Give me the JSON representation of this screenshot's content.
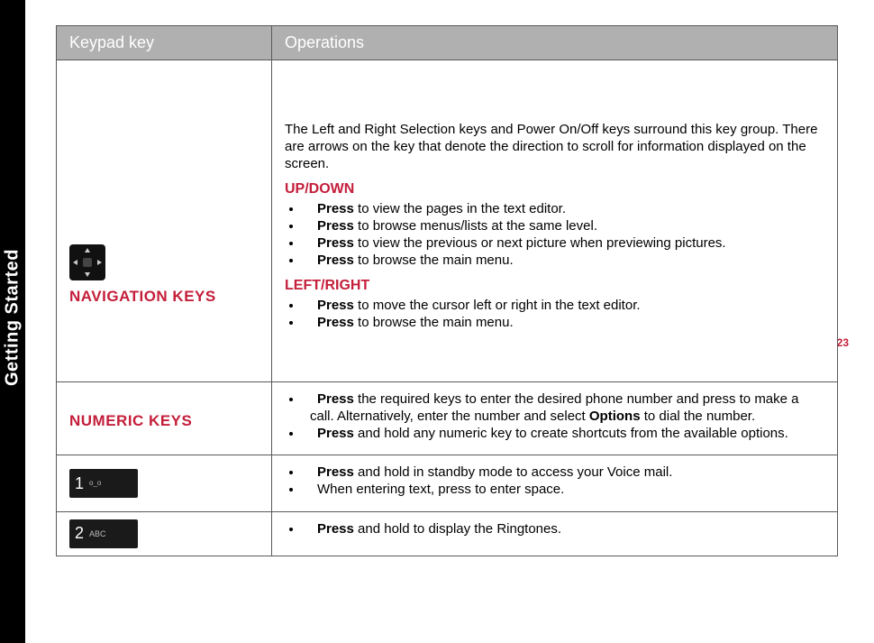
{
  "page_number": "23",
  "section_tab": "Getting Started",
  "headers": {
    "col1": "Keypad key",
    "col2": "Operations"
  },
  "rows": {
    "nav": {
      "label": "NAVIGATION KEYS",
      "intro": "The Left and Right Selection keys and Power On/Off keys surround this key group. There are arrows on the key that denote the direction to scroll for information displayed on the screen.",
      "updown_header": "UP/DOWN",
      "updown": [
        {
          "bold": "Press",
          "text": " to view the pages in the text editor."
        },
        {
          "bold": "Press",
          "text": " to browse menus/lists at the same level."
        },
        {
          "bold": "Press",
          "text": " to view the previous or next picture when previewing pictures."
        },
        {
          "bold": "Press",
          "text": " to browse the main menu."
        }
      ],
      "leftright_header": "LEFT/RIGHT",
      "leftright": [
        {
          "bold": "Press",
          "text": " to move the cursor left or right in the text editor."
        },
        {
          "bold": "Press",
          "text": " to browse the main menu."
        }
      ]
    },
    "numeric": {
      "label": "NUMERIC KEYS",
      "items": [
        {
          "bold": "Press",
          "text1": " the required keys to enter the desired phone number and press to make a call. Alternatively, enter the number and select ",
          "bold2": "Options",
          "text2": " to dial the number."
        },
        {
          "bold": "Press",
          "text": " and hold any numeric key to create shortcuts from the available options."
        }
      ]
    },
    "key1": {
      "digit": "1",
      "sub": "o_o",
      "items": [
        {
          "bold": "Press",
          "text": " and hold in standby mode to access your Voice mail."
        },
        {
          "plain": "When entering text, press to enter space."
        }
      ]
    },
    "key2": {
      "digit": "2",
      "sub": "ABC",
      "items": [
        {
          "bold": "Press",
          "text": " and hold to display the Ringtones."
        }
      ]
    }
  }
}
